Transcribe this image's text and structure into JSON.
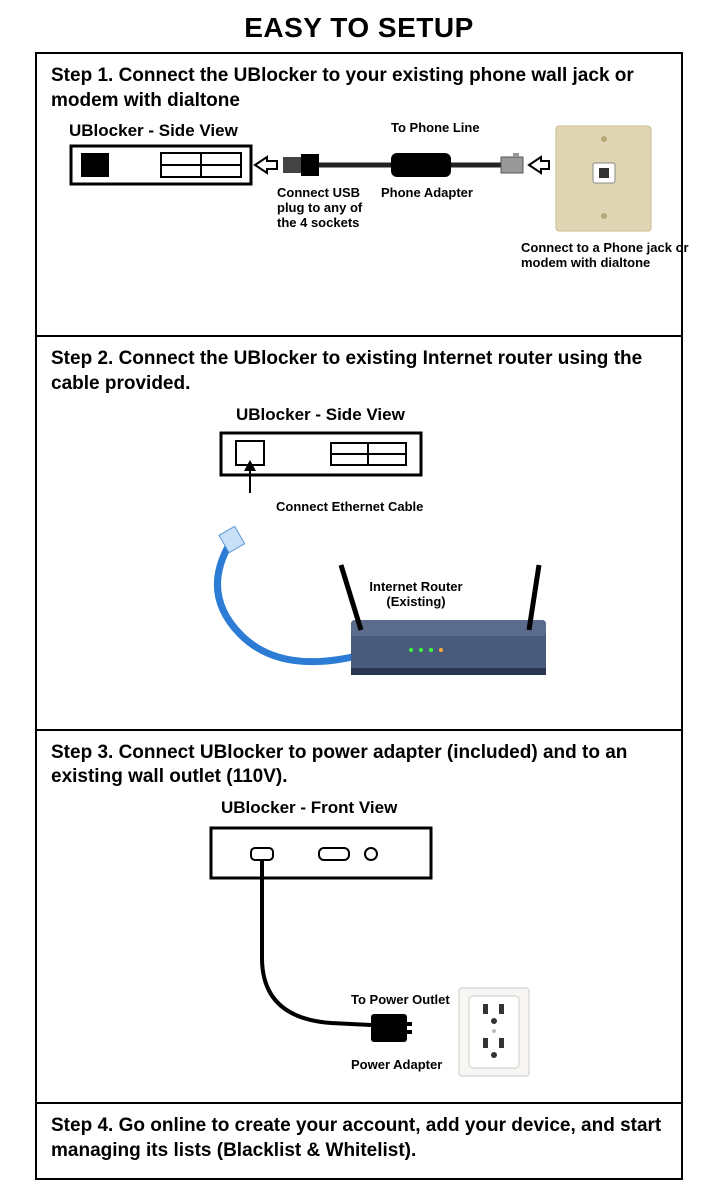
{
  "title": "EASY TO SETUP",
  "steps": [
    {
      "text": "Step 1. Connect the UBlocker to your existing phone wall jack or modem with dialtone",
      "subtitle": "UBlocker - Side View",
      "labels": {
        "to_phone": "To Phone Line",
        "phone_adapter": "Phone Adapter",
        "usb_plug": "Connect USB plug to any of the 4 sockets",
        "jack": "Connect to a Phone jack or modem with dialtone"
      }
    },
    {
      "text": "Step 2. Connect the UBlocker to existing Internet router using the cable provided.",
      "subtitle": "UBlocker - Side View",
      "labels": {
        "ethernet": "Connect Ethernet Cable",
        "router": "Internet Router (Existing)"
      }
    },
    {
      "text": "Step 3. Connect UBlocker to power adapter (included) and to an existing wall outlet (110V).",
      "subtitle": "UBlocker - Front View",
      "labels": {
        "to_power": "To Power Outlet",
        "power_adapter": "Power Adapter"
      }
    },
    {
      "text": "Step 4. Go online to create your account, add your device, and start managing its lists (Blacklist & Whitelist)."
    }
  ]
}
